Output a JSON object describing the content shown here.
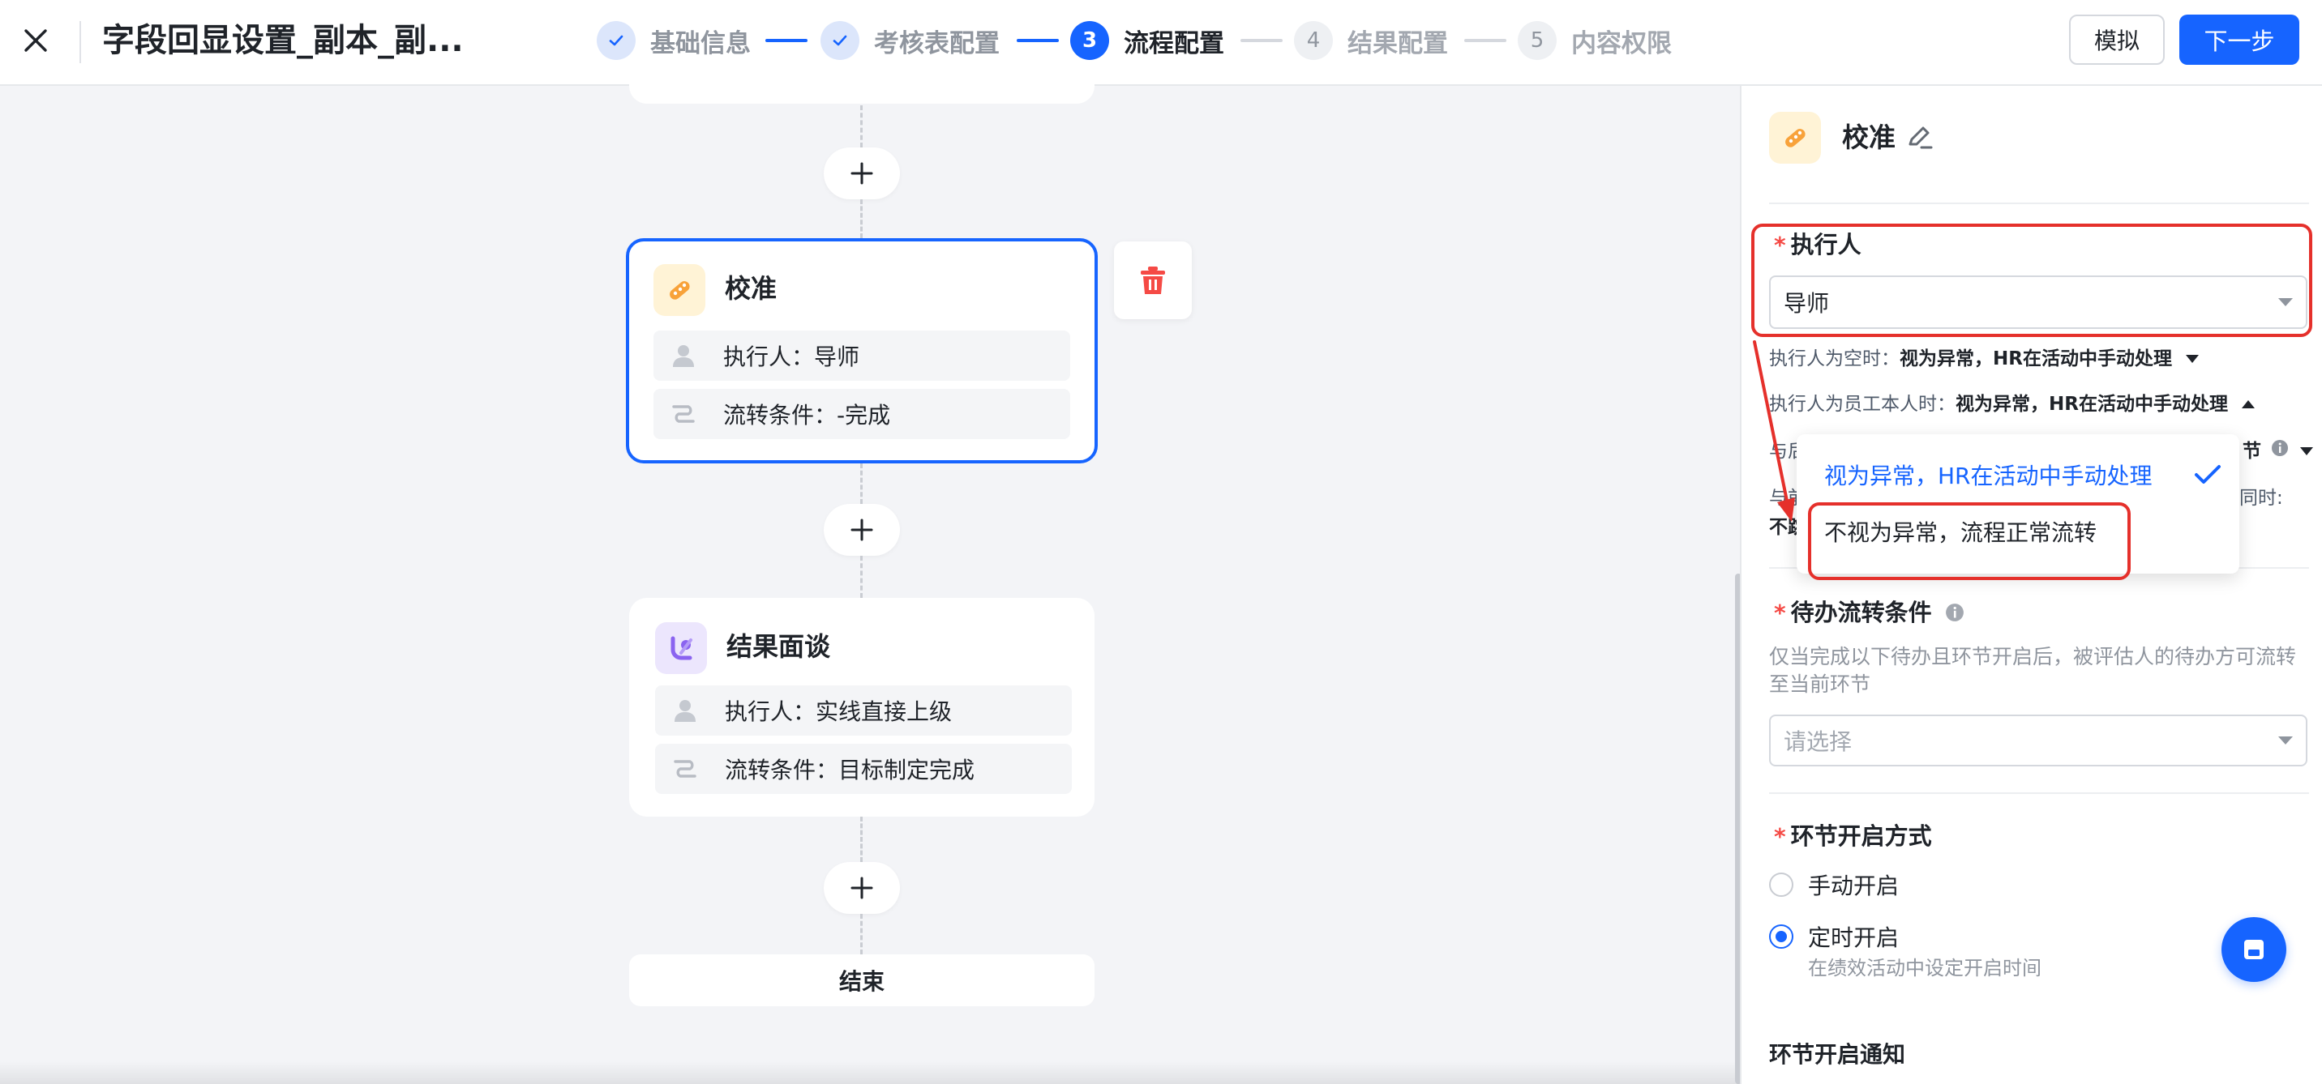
{
  "header": {
    "title": "字段回显设置_副本_副...",
    "steps": [
      {
        "number": "1",
        "label": "基础信息",
        "state": "done"
      },
      {
        "number": "2",
        "label": "考核表配置",
        "state": "done"
      },
      {
        "number": "3",
        "label": "流程配置",
        "state": "current"
      },
      {
        "number": "4",
        "label": "结果配置",
        "state": "todo"
      },
      {
        "number": "5",
        "label": "内容权限",
        "state": "todo"
      }
    ],
    "simulate_label": "模拟",
    "next_label": "下一步"
  },
  "canvas": {
    "nodes": [
      {
        "title": "校准",
        "icon": "calibration-icon",
        "rows": [
          {
            "icon": "person-icon",
            "text": "执行人：导师"
          },
          {
            "icon": "flow-condition-icon",
            "text": "流转条件：-完成"
          }
        ]
      },
      {
        "title": "结果面谈",
        "icon": "interview-icon",
        "rows": [
          {
            "icon": "person-icon",
            "text": "执行人：实线直接上级"
          },
          {
            "icon": "flow-condition-icon",
            "text": "流转条件：目标制定完成"
          }
        ]
      }
    ],
    "end_label": "结束"
  },
  "panel": {
    "node_title": "校准",
    "executor_label": "执行人",
    "executor_value": "导师",
    "empty_executor_prefix": "执行人为空时：",
    "empty_executor_value": "视为异常，HR在活动中手动处理",
    "self_executor_prefix": "执行人为员工本人时：",
    "self_executor_value": "视为异常，HR在活动中手动处理",
    "hidden_row1_left": "与后",
    "hidden_row1_right": "节",
    "hidden_row2_left": "与前",
    "hidden_row2_right": "同时:",
    "hidden_row3_left": "不跳",
    "dropdown_options": [
      {
        "label": "视为异常，HR在活动中手动处理",
        "selected": true
      },
      {
        "label": "不视为异常，流程正常流转",
        "selected": false
      }
    ],
    "pending_label": "待办流转条件",
    "pending_desc": "仅当完成以下待办且环节开启后，被评估人的待办方可流转至当前环节",
    "pending_placeholder": "请选择",
    "open_mode_label": "环节开启方式",
    "open_options": [
      {
        "label": "手动开启",
        "checked": false,
        "hint": ""
      },
      {
        "label": "定时开启",
        "checked": true,
        "hint": "在绩效活动中设定开启时间"
      }
    ],
    "notify_label": "环节开启通知"
  },
  "colors": {
    "primary": "#1664ff",
    "annotation_red": "#e5302b",
    "delete_red": "#f54a45"
  }
}
